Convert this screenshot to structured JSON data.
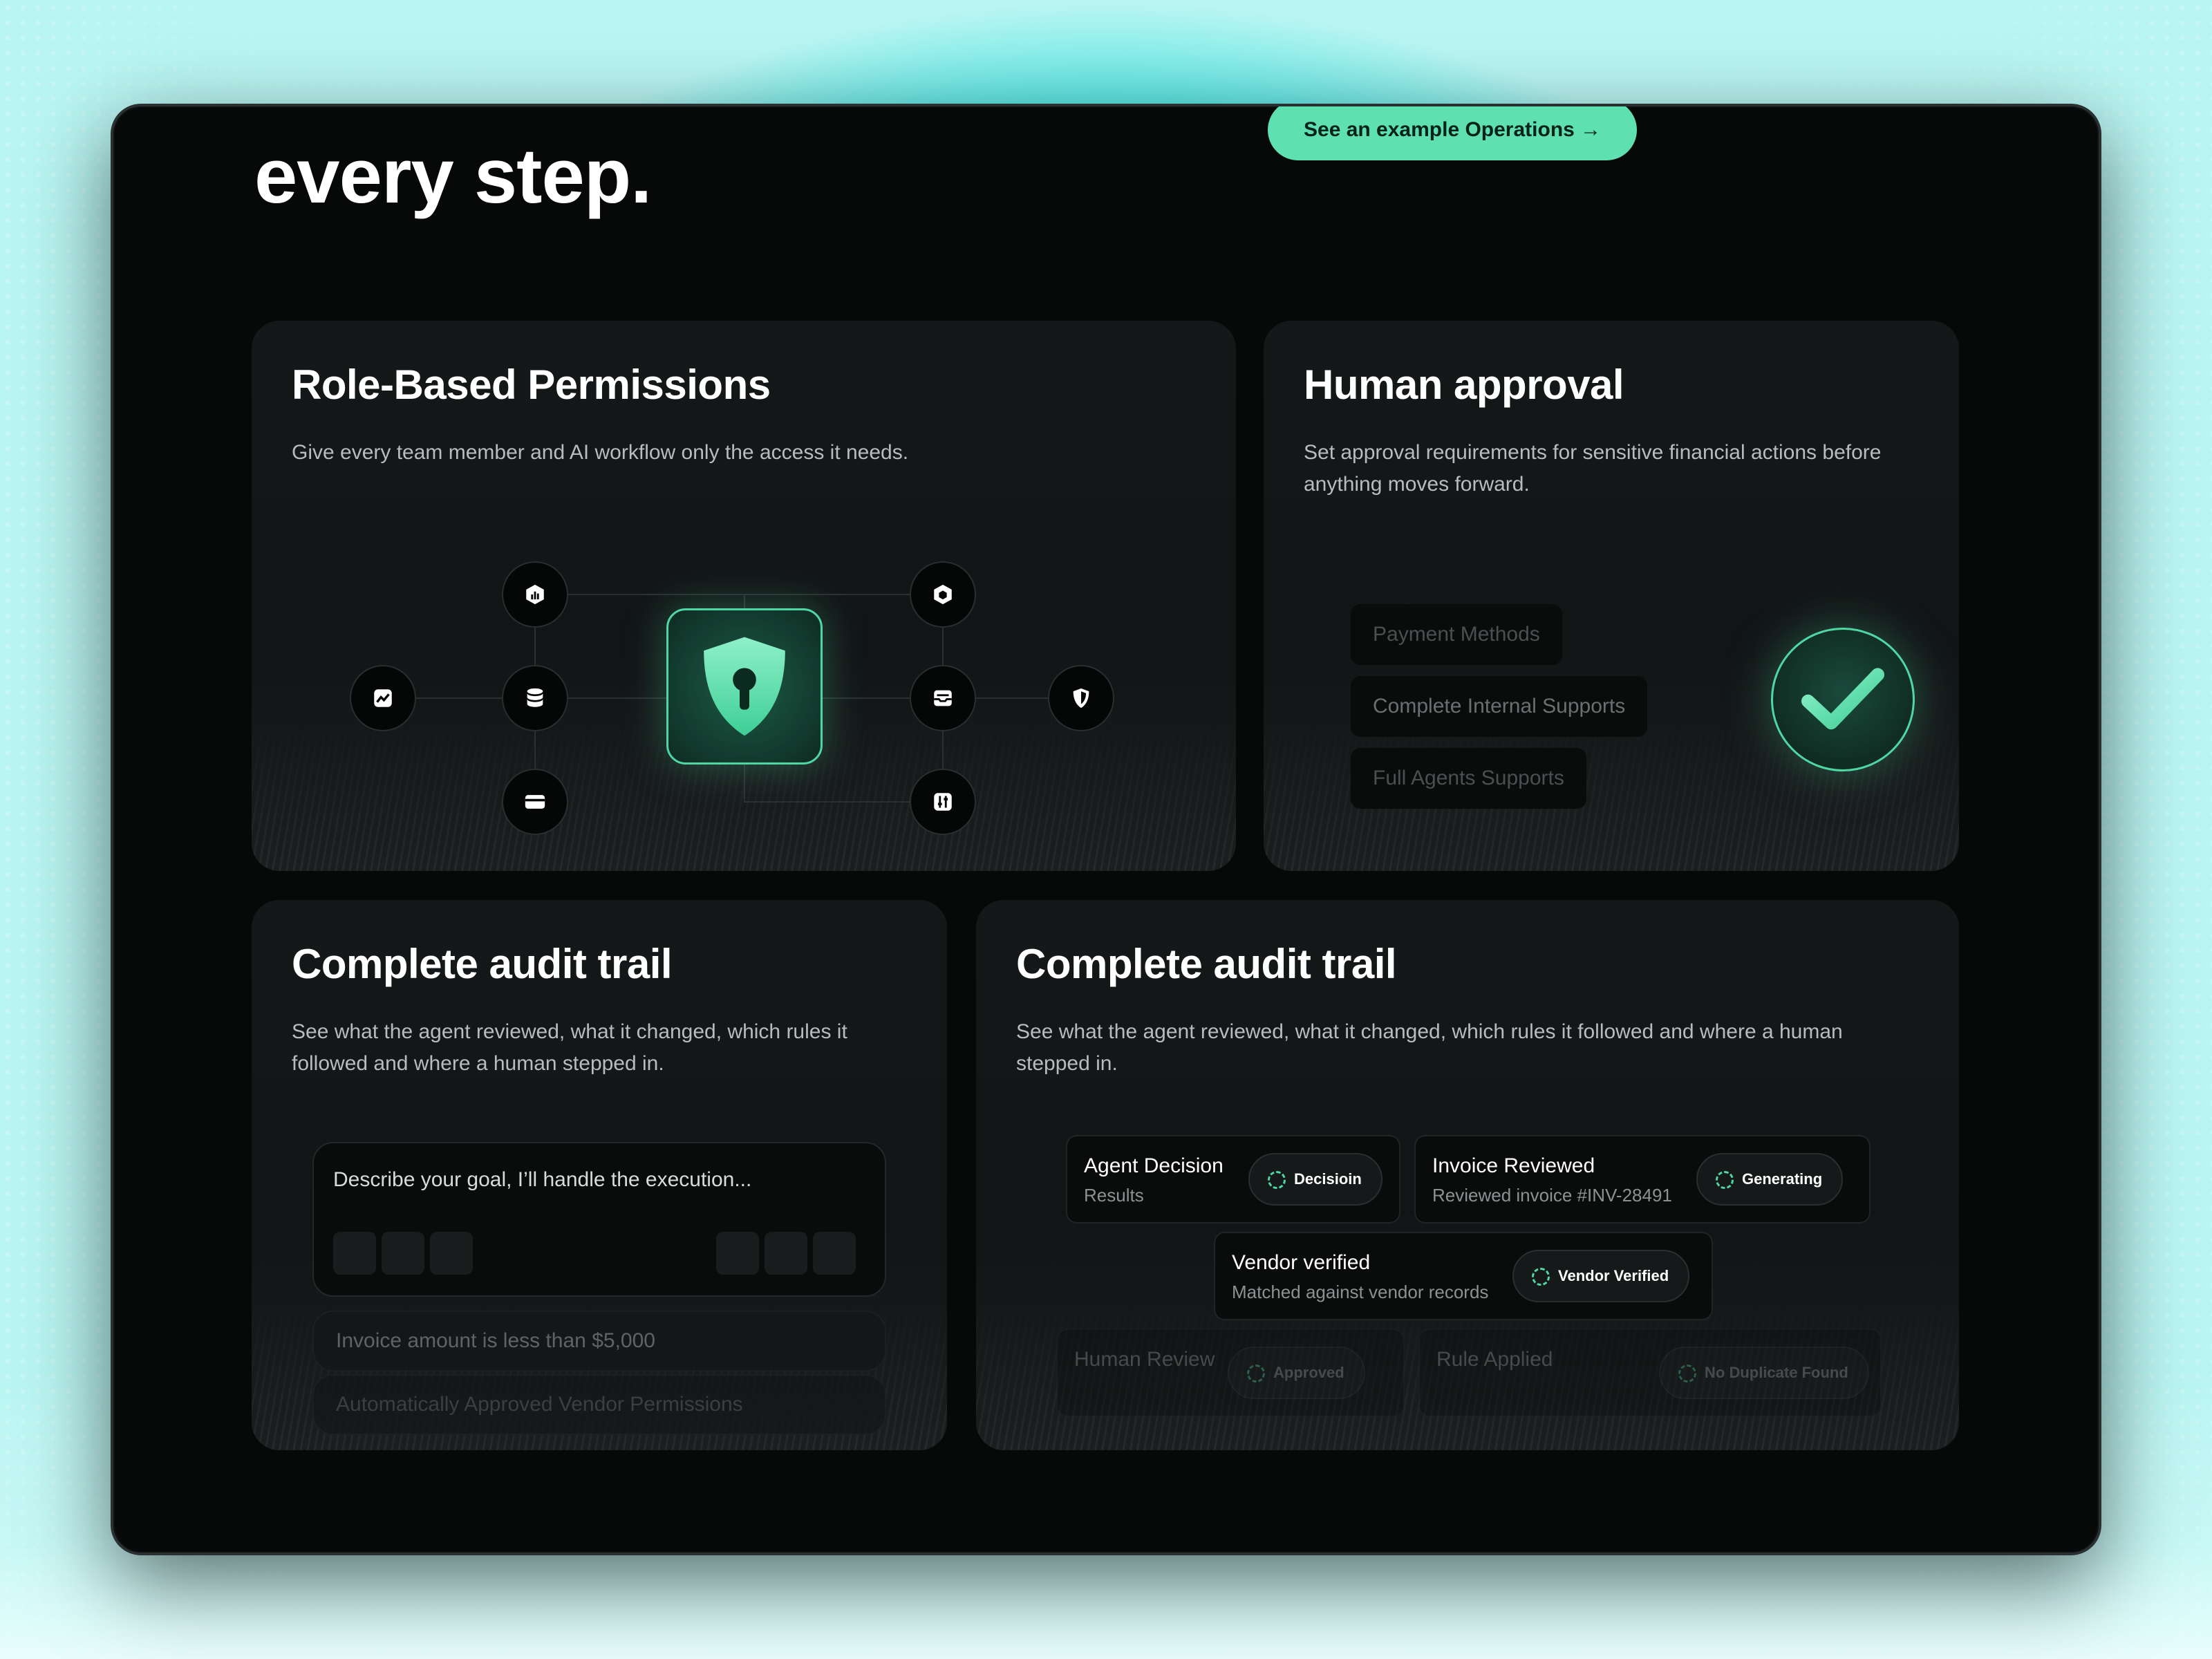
{
  "hero": {
    "title": "every step.",
    "cta_label": "See an example Operations →"
  },
  "colors": {
    "accent": "#5fe0b0",
    "frame_bg": "#070909",
    "card_bg": "#151819"
  },
  "cards": {
    "permissions": {
      "title": "Role-Based Permissions",
      "description": "Give every team member and AI workflow only the access it needs.",
      "icons": [
        "chart-icon",
        "bar-chart-icon",
        "database-icon",
        "card-icon",
        "shield-lock-icon",
        "cube-icon",
        "inbox-icon",
        "sliders-icon",
        "shield-icon"
      ]
    },
    "approval": {
      "title": "Human approval",
      "description_line1": "Set approval requirements for sensitive financial actions before",
      "description_line2": "anything moves forward.",
      "chips": [
        "Payment Methods",
        "Complete Internal Supports",
        "Full Agents Supports"
      ]
    },
    "audit_left": {
      "title": "Complete audit trail",
      "description_line1": "See what the agent reviewed, what it changed, which rules it",
      "description_line2": "followed and where a human stepped in.",
      "prompt_placeholder": "Describe your goal, I’ll handle the execution...",
      "rows": [
        "Invoice amount is less than $5,000",
        "Automatically Approved Vendor Permissions"
      ]
    },
    "audit_right": {
      "title": "Complete audit trail",
      "description_line1": "See what the agent reviewed, what it changed, which rules it followed and where a human",
      "description_line2": "stepped in.",
      "tiles": [
        {
          "title": "Agent Decision",
          "sub": "Results",
          "badge": "Decisioin"
        },
        {
          "title": "Invoice Reviewed",
          "sub": "Reviewed invoice #INV-28491",
          "badge": "Generating"
        },
        {
          "title": "Vendor verified",
          "sub": "Matched against vendor records",
          "badge": "Vendor Verified"
        },
        {
          "title": "Human Review",
          "sub": "",
          "badge": "Approved"
        },
        {
          "title": "Rule Applied",
          "sub": "",
          "badge": "No Duplicate Found"
        }
      ]
    }
  }
}
